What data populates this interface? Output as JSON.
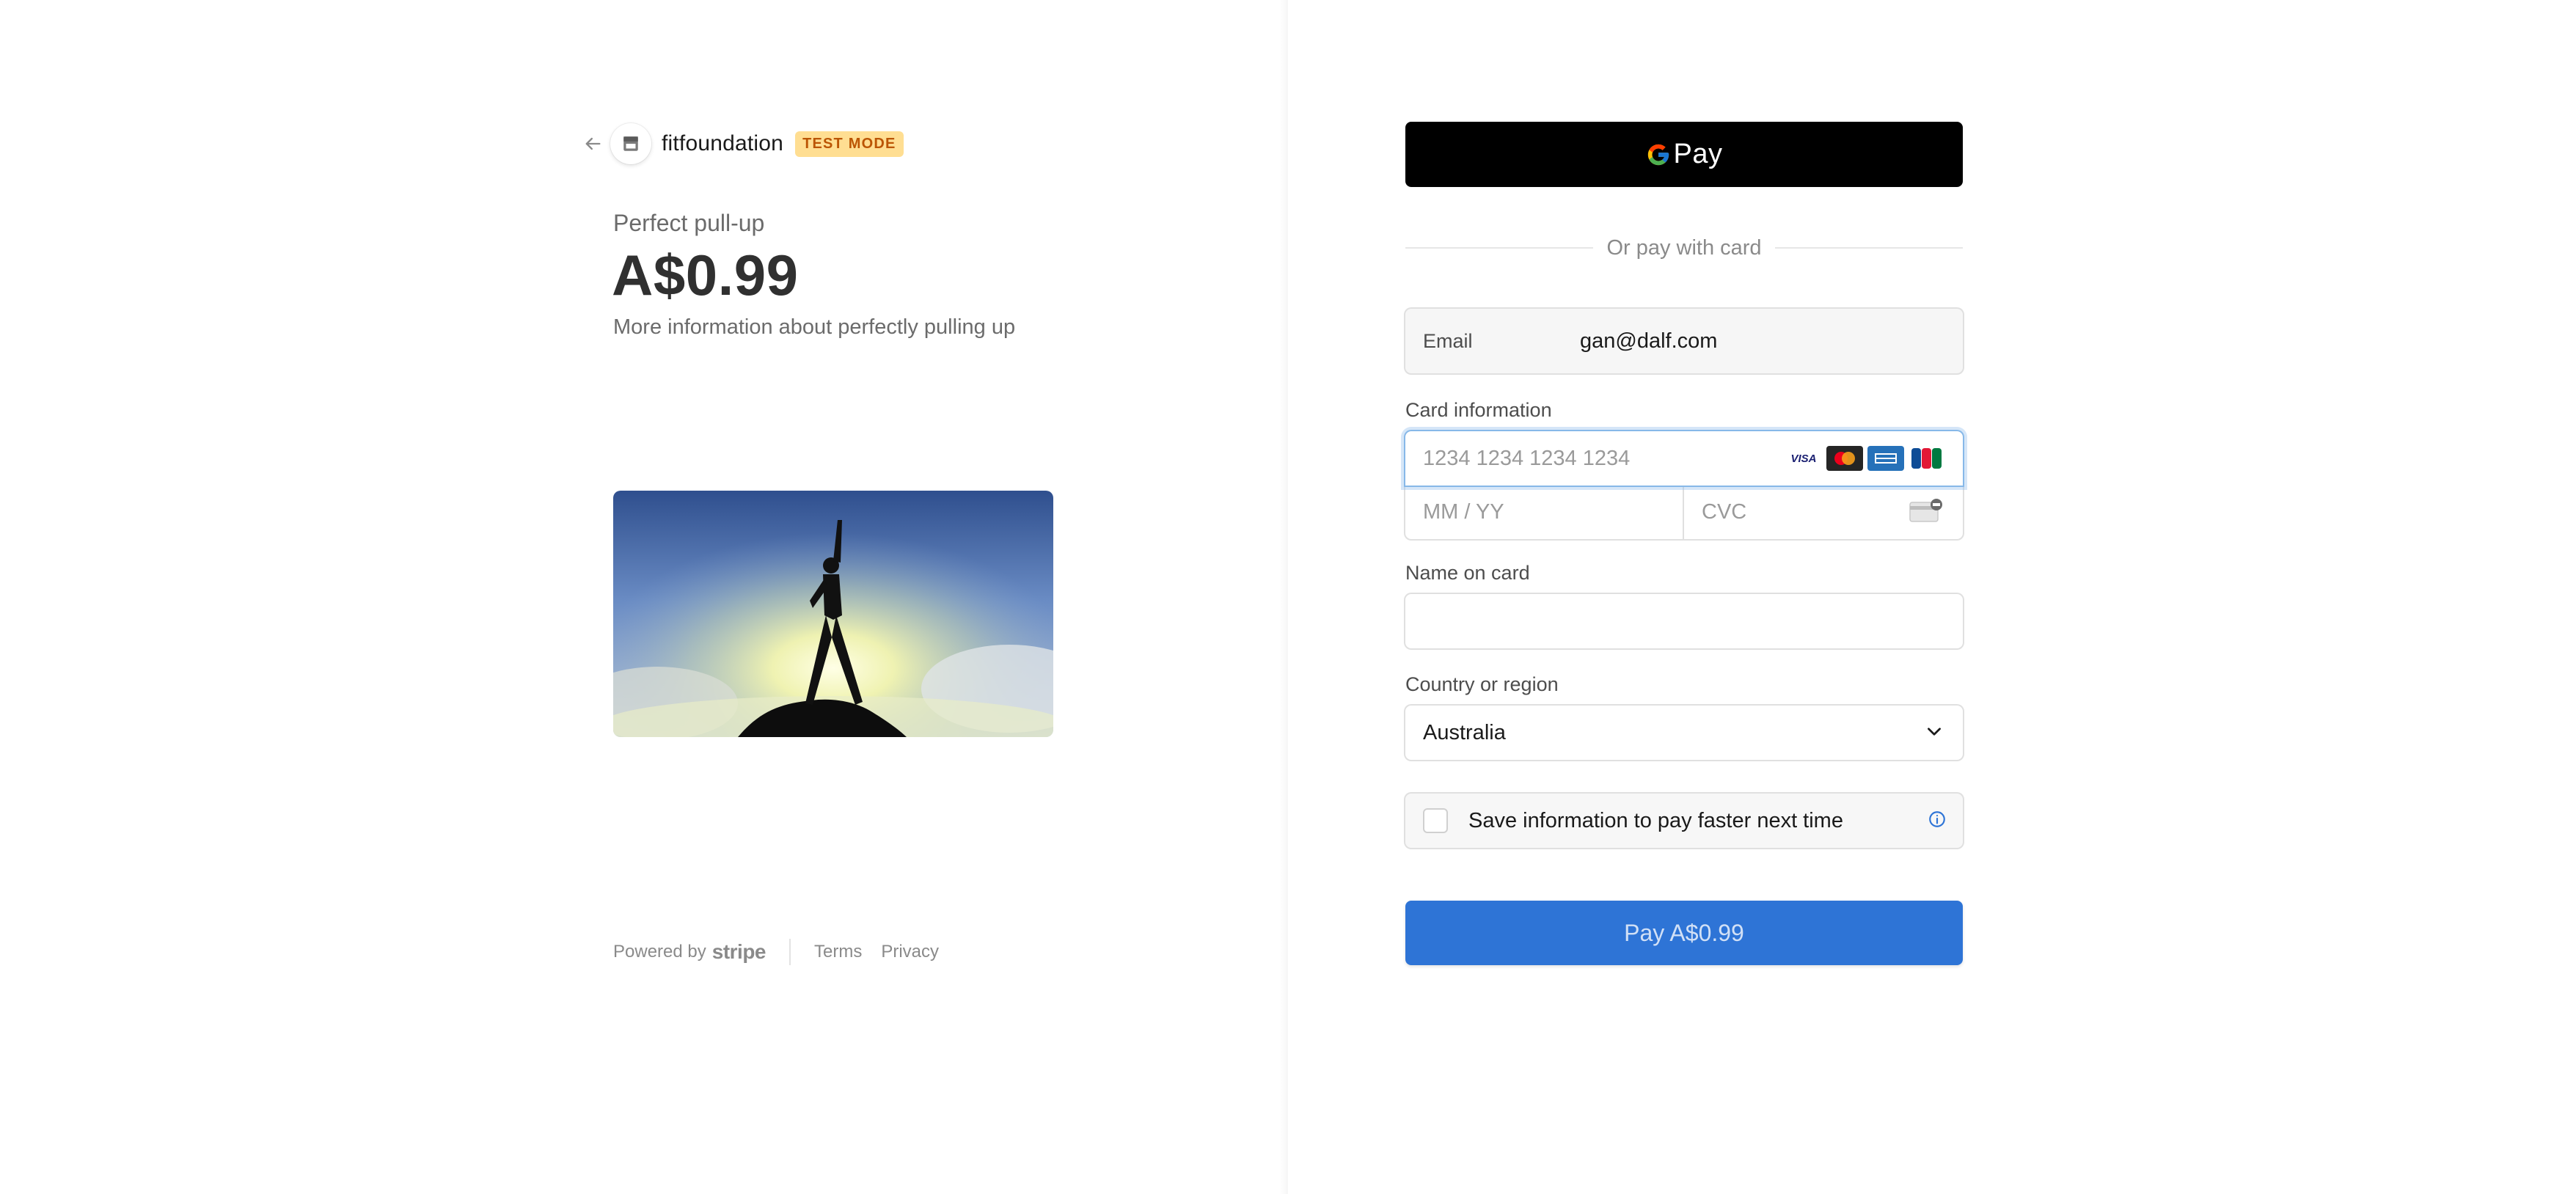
{
  "merchant": {
    "name": "fitfoundation",
    "mode_badge": "TEST MODE"
  },
  "product": {
    "name": "Perfect pull-up",
    "price": "A$0.99",
    "description": "More information about perfectly pulling up"
  },
  "footer": {
    "powered_by": "Powered by",
    "stripe": "stripe",
    "terms": "Terms",
    "privacy": "Privacy"
  },
  "payment": {
    "gpay_label": "Pay",
    "divider_text": "Or pay with card",
    "email_label": "Email",
    "email_value": "gan@dalf.com",
    "card_label": "Card information",
    "card_number_placeholder": "1234 1234 1234 1234",
    "expiry_placeholder": "MM / YY",
    "cvc_placeholder": "CVC",
    "card_brands": [
      "VISA",
      "mastercard",
      "amex",
      "jcb"
    ],
    "name_label": "Name on card",
    "name_value": "",
    "country_label": "Country or region",
    "country_value": "Australia",
    "save_info_label": "Save information to pay faster next time",
    "save_info_checked": false,
    "pay_button_label": "Pay A$0.99"
  },
  "colors": {
    "accent": "#2e74d6",
    "test_badge_bg": "#ffde92",
    "test_badge_text": "#bb5504",
    "focus_ring": "#87b8e8"
  }
}
